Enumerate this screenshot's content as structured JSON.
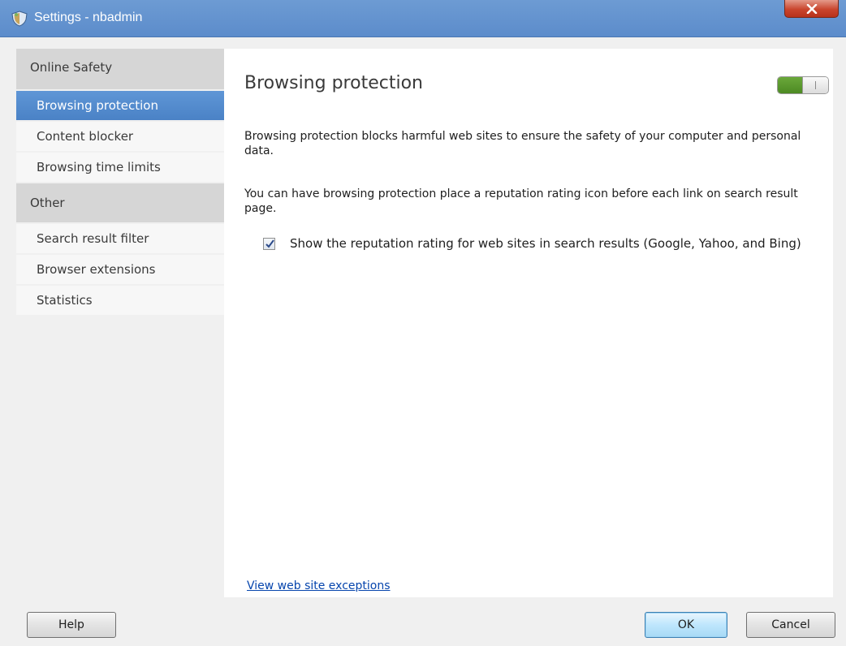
{
  "window": {
    "title": "Settings - nbadmin",
    "close_label": "X"
  },
  "sidebar": {
    "sections": [
      {
        "header": "Online Safety",
        "items": [
          "Browsing protection",
          "Content blocker",
          "Browsing time limits"
        ]
      },
      {
        "header": "Other",
        "items": [
          "Search result filter",
          "Browser extensions",
          "Statistics"
        ]
      }
    ],
    "selected": "Browsing protection"
  },
  "main": {
    "title": "Browsing protection",
    "toggle_on": true,
    "description": "Browsing protection blocks harmful web sites to ensure the safety of your computer and personal data.",
    "reputation_text": "You can have browsing protection place a reputation rating icon before each link on search result page.",
    "checkbox": {
      "checked": true,
      "label": "Show the reputation rating for web sites in search results (Google, Yahoo, and Bing)"
    },
    "exceptions_link": "View web site exceptions"
  },
  "footer": {
    "help_label": "Help",
    "ok_label": "OK",
    "cancel_label": "Cancel"
  },
  "colors": {
    "titlebar": "#5c8ccb",
    "selected_item": "#4a82c6",
    "toggle_on": "#4d8a23",
    "link": "#0645ad"
  }
}
